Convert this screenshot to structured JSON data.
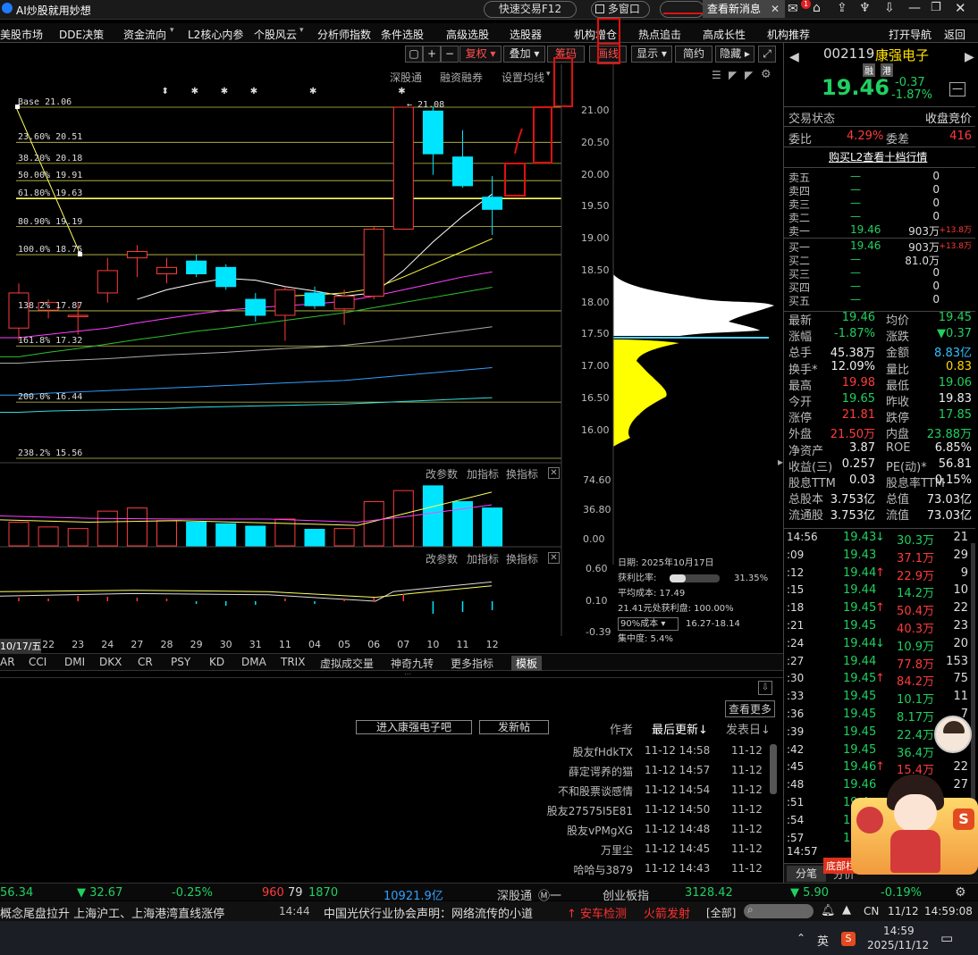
{
  "title_bar": {
    "app_title": "AI炒股就用妙想",
    "quick_trade": "快速交易F12",
    "multi_window": "多窗口",
    "view_news": "查看新消息",
    "badge": "1"
  },
  "menu": [
    "美股市场",
    "DDE决策",
    "资金流向",
    "L2核心内参",
    "个股风云",
    "分析师指数",
    "条件选股",
    "高级选股",
    "选股器",
    "机构增仓",
    "热点追击",
    "高成长性",
    "机构推荐",
    "打开导航",
    "返回"
  ],
  "toolbar": {
    "plus": "+",
    "minus": "−",
    "fuquan": "复权",
    "diejia": "叠加",
    "chouma": "筹码",
    "huaxian": "画线",
    "xianshi": "显示",
    "jianyue": "简约",
    "yincang": "隐藏",
    "shengutong": "深股通",
    "rongzi": "融资融券",
    "set_ma": "设置均线"
  },
  "chart_data": [
    {
      "type": "candlestick",
      "categories": [
        "10/17",
        "22",
        "23",
        "24",
        "27",
        "28",
        "29",
        "30",
        "31",
        "11",
        "04",
        "05",
        "06",
        "07",
        "10",
        "11",
        "12"
      ],
      "date_ticks": [
        "10/17/五",
        "22",
        "23",
        "24",
        "27",
        "28",
        "29",
        "30",
        "31",
        "11",
        "04",
        "05",
        "06",
        "07",
        "10",
        "11",
        "12"
      ],
      "candles": [
        {
          "open": 17.6,
          "close": 18.15,
          "high": 18.3,
          "low": 17.4
        },
        {
          "open": 17.88,
          "close": 18.0,
          "high": 18.05,
          "low": 17.75
        },
        {
          "open": 17.8,
          "close": 17.8,
          "high": 18.0,
          "low": 17.5
        },
        {
          "open": 18.15,
          "close": 18.5,
          "high": 18.7,
          "low": 18.0
        },
        {
          "open": 18.7,
          "close": 18.8,
          "high": 18.9,
          "low": 18.4
        },
        {
          "open": 18.45,
          "close": 18.55,
          "high": 18.7,
          "low": 18.3
        },
        {
          "open": 18.65,
          "close": 18.45,
          "high": 18.75,
          "low": 18.4
        },
        {
          "open": 18.55,
          "close": 18.25,
          "high": 18.6,
          "low": 18.2
        },
        {
          "open": 18.05,
          "close": 17.8,
          "high": 18.15,
          "low": 17.7
        },
        {
          "open": 17.8,
          "close": 18.2,
          "high": 18.25,
          "low": 17.4
        },
        {
          "open": 18.15,
          "close": 17.95,
          "high": 18.25,
          "low": 17.9
        },
        {
          "open": 17.9,
          "close": 18.1,
          "high": 18.2,
          "low": 17.65
        },
        {
          "open": 18.1,
          "close": 19.15,
          "high": 19.2,
          "low": 18.05
        },
        {
          "open": 19.15,
          "close": 21.06,
          "high": 21.06,
          "low": 19.15
        },
        {
          "open": 21.0,
          "close": 20.33,
          "high": 21.08,
          "low": 20.0
        },
        {
          "open": 20.28,
          "close": 19.83,
          "high": 20.7,
          "low": 19.8
        },
        {
          "open": 19.65,
          "close": 19.46,
          "high": 19.98,
          "low": 19.06
        }
      ],
      "ylim": [
        15.3,
        21.5
      ],
      "yticks": [
        "21.00",
        "20.50",
        "20.00",
        "19.50",
        "19.00",
        "18.50",
        "18.00",
        "17.50",
        "17.00",
        "16.50",
        "16.00"
      ],
      "fib_levels": [
        {
          "label": "Base   21.06",
          "value": 21.06
        },
        {
          "label": "23.60% 20.51",
          "value": 20.51
        },
        {
          "label": "38.20% 20.18",
          "value": 20.18
        },
        {
          "label": "50.00% 19.91",
          "value": 19.91
        },
        {
          "label": "61.80% 19.63",
          "value": 19.63
        },
        {
          "label": "80.90% 19.19",
          "value": 19.19
        },
        {
          "label": "100.0% 18.75",
          "value": 18.75
        },
        {
          "label": "138.2% 17.87",
          "value": 17.87
        },
        {
          "label": "161.8% 17.32",
          "value": 17.32
        },
        {
          "label": "200.0% 16.44",
          "value": 16.44
        },
        {
          "label": "238.2% 15.56",
          "value": 15.56
        }
      ],
      "peak_label": "← 21.08",
      "star_marks": [
        "⬍",
        "✱",
        "✱",
        "✱",
        "✱",
        "✱"
      ],
      "ma_series": [
        {
          "color": "#ffffff",
          "values": [
            null,
            null,
            null,
            null,
            18.05,
            18.2,
            18.3,
            18.38,
            18.35,
            18.25,
            18.18,
            18.1,
            18.15,
            18.5,
            18.95,
            19.35,
            19.7
          ]
        },
        {
          "color": "#ffff40",
          "values": [
            null,
            null,
            null,
            null,
            null,
            null,
            null,
            null,
            null,
            18.1,
            18.12,
            18.15,
            18.22,
            18.4,
            18.6,
            18.8,
            19.0
          ]
        },
        {
          "color": "#ff40ff",
          "values": [
            17.45,
            17.5,
            17.55,
            17.6,
            17.68,
            17.75,
            17.82,
            17.88,
            17.92,
            17.95,
            17.98,
            18.02,
            18.1,
            18.2,
            18.3,
            18.4,
            18.48
          ]
        },
        {
          "color": "#30c030",
          "values": [
            17.15,
            17.22,
            17.28,
            17.35,
            17.42,
            17.48,
            17.55,
            17.6,
            17.66,
            17.72,
            17.78,
            17.84,
            17.92,
            18.0,
            18.08,
            18.16,
            18.24
          ]
        },
        {
          "color": "#aaaaaa",
          "values": [
            17.05,
            17.08,
            17.1,
            17.12,
            17.15,
            17.18,
            17.2,
            17.22,
            17.25,
            17.28,
            17.3,
            17.33,
            17.38,
            17.44,
            17.5,
            17.56,
            17.62
          ]
        },
        {
          "color": "#30a0ff",
          "values": [
            16.55,
            16.58,
            16.6,
            16.62,
            16.64,
            16.66,
            16.68,
            16.7,
            16.72,
            16.74,
            16.76,
            16.78,
            16.82,
            16.86,
            16.9,
            16.94,
            16.98
          ]
        },
        {
          "color": "#30e0e0",
          "values": [
            16.28,
            16.3,
            16.31,
            16.32,
            16.33,
            16.34,
            16.36,
            16.37,
            16.38,
            16.39,
            16.4,
            16.41,
            16.43,
            16.45,
            16.47,
            16.49,
            16.51
          ]
        }
      ]
    },
    {
      "type": "bar",
      "name": "volume",
      "yticks": [
        "74.60",
        "36.80",
        "0.00"
      ],
      "ylim": [
        0,
        80
      ],
      "values": [
        22,
        16,
        14,
        36,
        40,
        24,
        22,
        20,
        17,
        26,
        13,
        14,
        48,
        62,
        68,
        48,
        40
      ]
    },
    {
      "type": "line",
      "name": "indicator",
      "yticks": [
        "0.60",
        "0.10",
        "-0.39"
      ],
      "ylim": [
        -0.39,
        0.6
      ]
    }
  ],
  "panels": {
    "gai_canshu": "改参数",
    "jia_zhibiao": "加指标",
    "huan_zhibiao": "换指标"
  },
  "chip_dist": {
    "date": "日期: 2025年10月17日",
    "profit_label": "获利比率:",
    "profit_value": "31.35%",
    "profit_ratio": 0.3135,
    "avg_cost": "平均成本: 17.49",
    "at_price": "21.41元处获利盘: 100.00%",
    "cost_select": "90%成本",
    "cost_range": "16.27-18.14",
    "concentration": "集中度: 5.4%"
  },
  "indicator_tabs": [
    "AR",
    "CCI",
    "DMI",
    "DKX",
    "CR",
    "PSY",
    "KD",
    "DMA",
    "TRIX",
    "虚拟成交量",
    "神奇九转",
    "更多指标",
    "模板"
  ],
  "forum": {
    "check_more": "查看更多",
    "enter_btn": "进入康强电子吧",
    "post_btn": "发新帖",
    "col_author": "作者",
    "col_updated": "最后更新↓",
    "col_posted": "发表日↓",
    "posts": [
      {
        "author": "股友fHdkTX",
        "updated": "11-12 14:58",
        "posted": "11-12"
      },
      {
        "author": "薛定谔养的猫",
        "updated": "11-12 14:57",
        "posted": "11-12"
      },
      {
        "author": "不和股票谈感情",
        "updated": "11-12 14:54",
        "posted": "11-12"
      },
      {
        "author": "股友27575I5E81",
        "updated": "11-12 14:50",
        "posted": "11-12"
      },
      {
        "author": "股友vPMgXG",
        "updated": "11-12 14:48",
        "posted": "11-12"
      },
      {
        "author": "万里尘",
        "updated": "11-12 14:45",
        "posted": "11-12"
      },
      {
        "author": "哈哈与3879",
        "updated": "11-12 14:43",
        "posted": "11-12"
      }
    ]
  },
  "quote": {
    "code": "002119",
    "name": "康强电子",
    "tag1": "融",
    "tag2": "港",
    "price": "19.46",
    "change": "-0.37",
    "change_pct": "-1.87%",
    "status_label": "交易状态",
    "status_value": "收盘竞价",
    "weibi_label": "委比",
    "weibi_value": "4.29%",
    "weicha_label": "委差",
    "weicha_value": "416",
    "buy_l2": "购买L2查看十档行情",
    "sell": [
      {
        "label": "卖五",
        "price": "—",
        "vol": "0",
        "extra": ""
      },
      {
        "label": "卖四",
        "price": "—",
        "vol": "0",
        "extra": ""
      },
      {
        "label": "卖三",
        "price": "—",
        "vol": "0",
        "extra": ""
      },
      {
        "label": "卖二",
        "price": "—",
        "vol": "0",
        "extra": ""
      },
      {
        "label": "卖一",
        "price": "19.46",
        "vol": "903万",
        "extra": "+13.8万"
      }
    ],
    "buy": [
      {
        "label": "买一",
        "price": "19.46",
        "vol": "903万",
        "extra": "+13.8万"
      },
      {
        "label": "买二",
        "price": "—",
        "vol": "81.0万",
        "extra": ""
      },
      {
        "label": "买三",
        "price": "—",
        "vol": "0",
        "extra": ""
      },
      {
        "label": "买四",
        "price": "—",
        "vol": "0",
        "extra": ""
      },
      {
        "label": "买五",
        "price": "—",
        "vol": "0",
        "extra": ""
      }
    ],
    "stats": [
      {
        "l1": "最新",
        "v1": "19.46",
        "c1": "green",
        "l2": "均价",
        "v2": "19.45",
        "c2": "green"
      },
      {
        "l1": "涨幅",
        "v1": "-1.87%",
        "c1": "green",
        "l2": "涨跌",
        "v2": "▼0.37",
        "c2": "green"
      },
      {
        "l1": "总手",
        "v1": "45.38万",
        "c1": "white",
        "l2": "金额",
        "v2": "8.83亿",
        "c2": "cyan"
      },
      {
        "l1": "换手*",
        "v1": "12.09%",
        "c1": "white",
        "l2": "量比",
        "v2": "0.83",
        "c2": "yellow"
      },
      {
        "l1": "最高",
        "v1": "19.98",
        "c1": "red",
        "l2": "最低",
        "v2": "19.06",
        "c2": "green"
      },
      {
        "l1": "今开",
        "v1": "19.65",
        "c1": "green",
        "l2": "昨收",
        "v2": "19.83",
        "c2": "white"
      },
      {
        "l1": "涨停",
        "v1": "21.81",
        "c1": "red",
        "l2": "跌停",
        "v2": "17.85",
        "c2": "green"
      },
      {
        "l1": "外盘",
        "v1": "21.50万",
        "c1": "red",
        "l2": "内盘",
        "v2": "23.88万",
        "c2": "green"
      },
      {
        "l1": "净资产",
        "v1": "3.87",
        "c1": "white",
        "l2": "ROE",
        "v2": "6.85%",
        "c2": "white"
      },
      {
        "l1": "收益(三)",
        "v1": "0.257",
        "c1": "white",
        "l2": "PE(动)*",
        "v2": "56.81",
        "c2": "white"
      },
      {
        "l1": "股息TTM",
        "v1": "0.03",
        "c1": "white",
        "l2": "股息率TTM",
        "v2": "0.15%",
        "c2": "white"
      },
      {
        "l1": "总股本",
        "v1": "3.753亿",
        "c1": "white",
        "l2": "总值",
        "v2": "73.03亿",
        "c2": "white"
      },
      {
        "l1": "流通股",
        "v1": "3.753亿",
        "c1": "white",
        "l2": "流值",
        "v2": "73.03亿",
        "c2": "white"
      }
    ],
    "ticks": [
      {
        "time": "14:56",
        "price": "19.43",
        "arrow": "↓",
        "vol": "30.3万",
        "n": "21",
        "vc": "green"
      },
      {
        "time": ":09",
        "price": "19.43",
        "arrow": "",
        "vol": "37.1万",
        "n": "29",
        "vc": "red"
      },
      {
        "time": ":12",
        "price": "19.44",
        "arrow": "↑",
        "vol": "22.9万",
        "n": "9",
        "vc": "red"
      },
      {
        "time": ":15",
        "price": "19.44",
        "arrow": "",
        "vol": "14.2万",
        "n": "10",
        "vc": "green"
      },
      {
        "time": ":18",
        "price": "19.45",
        "arrow": "↑",
        "vol": "50.4万",
        "n": "22",
        "vc": "red"
      },
      {
        "time": ":21",
        "price": "19.45",
        "arrow": "",
        "vol": "40.3万",
        "n": "23",
        "vc": "red"
      },
      {
        "time": ":24",
        "price": "19.44",
        "arrow": "↓",
        "vol": "10.9万",
        "n": "20",
        "vc": "green"
      },
      {
        "time": ":27",
        "price": "19.44",
        "arrow": "",
        "vol": "77.8万",
        "n": "153",
        "vc": "red"
      },
      {
        "time": ":30",
        "price": "19.45",
        "arrow": "↑",
        "vol": "84.2万",
        "n": "75",
        "vc": "red"
      },
      {
        "time": ":33",
        "price": "19.45",
        "arrow": "",
        "vol": "10.1万",
        "n": "11",
        "vc": "green"
      },
      {
        "time": ":36",
        "price": "19.45",
        "arrow": "",
        "vol": "8.17万",
        "n": "7",
        "vc": "green"
      },
      {
        "time": ":39",
        "price": "19.45",
        "arrow": "",
        "vol": "22.4万",
        "n": "",
        "vc": "green"
      },
      {
        "time": ":42",
        "price": "19.45",
        "arrow": "",
        "vol": "36.4万",
        "n": "",
        "vc": "green"
      },
      {
        "time": ":45",
        "price": "19.46",
        "arrow": "↑",
        "vol": "15.4万",
        "n": "22",
        "vc": "red"
      },
      {
        "time": ":48",
        "price": "19.46",
        "arrow": "",
        "vol": "",
        "n": "27",
        "vc": "red"
      },
      {
        "time": ":51",
        "price": "19.4",
        "arrow": "",
        "vol": "",
        "n": "",
        "vc": "red"
      },
      {
        "time": ":54",
        "price": "19.4",
        "arrow": "",
        "vol": "",
        "n": "",
        "vc": "red"
      },
      {
        "time": ":57",
        "price": "19.4",
        "arrow": "",
        "vol": "",
        "n": "",
        "vc": "red"
      },
      {
        "time": "14:57",
        "price": "",
        "arrow": "",
        "vol": "",
        "n": "",
        "vc": "red"
      }
    ],
    "bottom_tabs": [
      "分笔",
      "分价",
      "底部栏"
    ]
  },
  "status": {
    "i1": "56.34",
    "i2": "▼ 32.67",
    "i3": "-0.25%",
    "i4": "960",
    "i5": "79",
    "i6": "1870",
    "i7": "10921.9亿",
    "sgt": "深股通",
    "sgt_icon": "Ⓜ一",
    "cyb": "创业板指",
    "cyb_val": "3128.42",
    "cyb_chg": "▼ 5.90",
    "cyb_pct": "-0.19%"
  },
  "news": {
    "left": "概念尾盘拉升  上海沪工、上海港湾直线涨停",
    "time": "14:44",
    "headline": "中国光伏行业协会声明：网络流传的小道",
    "alert1": "↑ 安车检测",
    "alert2": "火箭发射",
    "all": "[全部]",
    "cn": "CN",
    "date": "11/12",
    "clock": "14:59:08"
  },
  "taskbar": {
    "ime": "英",
    "time": "14:59",
    "date": "2025/11/12"
  },
  "colors": {
    "up": "#ff3b3b",
    "down": "#00e5ff",
    "fib": "#d8d860",
    "highlight": "#e01010"
  }
}
